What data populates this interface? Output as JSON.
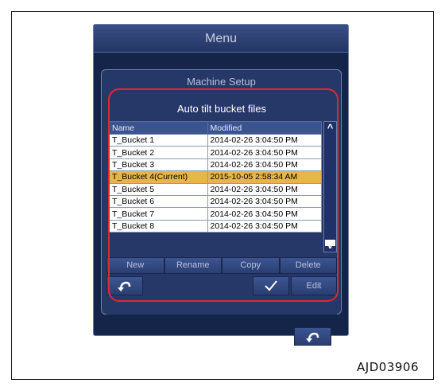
{
  "menu": {
    "title": "Menu"
  },
  "machine_setup": {
    "title": "Machine Setup"
  },
  "files": {
    "title": "Auto tilt bucket files",
    "columns": [
      "Name",
      "Modified"
    ],
    "rows": [
      {
        "name": "T_Bucket 1",
        "modified": "2014-02-26 3:04:50 PM"
      },
      {
        "name": "T_Bucket 2",
        "modified": "2014-02-26 3:04:50 PM"
      },
      {
        "name": "T_Bucket 3",
        "modified": "2014-02-26 3:04:50 PM"
      },
      {
        "name": "T_Bucket 4(Current)",
        "modified": "2015-10-05 2:58:34 AM"
      },
      {
        "name": "T_Bucket 5",
        "modified": "2014-02-26 3:04:50 PM"
      },
      {
        "name": "T_Bucket 6",
        "modified": "2014-02-26 3:04:50 PM"
      },
      {
        "name": "T_Bucket 7",
        "modified": "2014-02-26 3:04:50 PM"
      },
      {
        "name": "T_Bucket 8",
        "modified": "2014-02-26 3:04:50 PM"
      }
    ],
    "selected_index": 3,
    "scroll_up_icon": "chevron-up-icon",
    "scroll_down_icon": "chevron-down-icon"
  },
  "buttons": {
    "new": "New",
    "rename": "Rename",
    "copy": "Copy",
    "delete": "Delete",
    "edit": "Edit",
    "back_icon": "back-arrow-icon",
    "confirm_icon": "checkmark-icon"
  },
  "figure_id": "AJD03906",
  "colors": {
    "background": "#152449",
    "panel": "#263868",
    "selected_row": "#e9b54a",
    "highlight_outline": "#e0282d"
  }
}
